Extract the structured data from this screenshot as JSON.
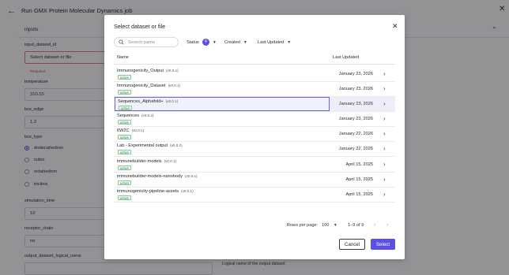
{
  "page": {
    "title": "Run GMX Protein Molecular Dynamics job",
    "section_title": "inputs",
    "fields": [
      {
        "label": "input_dataset_id",
        "value": "Select dataset or file",
        "required_note": "*Required"
      },
      {
        "label": "temperature",
        "value": "310.15"
      },
      {
        "label": "box_edge",
        "value": "1.2"
      },
      {
        "label": "box_type",
        "options": [
          "dodecahedron",
          "cubic",
          "octahedron",
          "triclinic"
        ],
        "selected": "dodecahedron"
      },
      {
        "label": "simulation_time",
        "value": "10"
      },
      {
        "label": "receptor_chain",
        "value": "no"
      },
      {
        "label": "output_dataset_logical_name",
        "value": ""
      }
    ],
    "right_hint_top": "d",
    "right_hint_bottom": "Logical name of the output dataset"
  },
  "modal": {
    "title": "Select dataset or file",
    "search": {
      "placeholder": "Search name",
      "value": ""
    },
    "filters": {
      "status_label": "Status",
      "status_count": "4",
      "created_label": "Created",
      "updated_label": "Last Updated"
    },
    "columns": {
      "name": "Name",
      "last_updated": "Last Updated"
    },
    "rows": [
      {
        "name": "Immunogenicity_Output",
        "version": "(v0.0.1)",
        "status": "active",
        "date": "January 23, 2026"
      },
      {
        "name": "Immunogenicity_Dataset",
        "version": "(v0.0.1)",
        "status": "active",
        "date": "January 23, 2026"
      },
      {
        "name": "Sequences_Alphafold+",
        "version": "(v0.0.1)",
        "status": "active",
        "date": "January 23, 2026"
      },
      {
        "name": "Sequences",
        "version": "(v0.0.2)",
        "status": "active",
        "date": "January 23, 2026"
      },
      {
        "name": "6W2C",
        "version": "(v0.0.1)",
        "status": "active",
        "date": "January 22, 2026"
      },
      {
        "name": "Lab - Experimental output",
        "version": "(v0.0.2)",
        "status": "active",
        "date": "January 22, 2026"
      },
      {
        "name": "immunebuilder-models",
        "version": "(v0.0.1)",
        "status": "active",
        "date": "April 15, 2025"
      },
      {
        "name": "immunebuilder-models-nanobody",
        "version": "(v0.0.1)",
        "status": "active",
        "date": "April 15, 2025"
      },
      {
        "name": "immunogenicity-pipeline-assets",
        "version": "(v0.0.1)",
        "status": "active",
        "date": "April 15, 2025"
      }
    ],
    "highlighted_row_index": 2,
    "pagination": {
      "rows_per_page_label": "Rows per page:",
      "rows_per_page": "100",
      "range": "1–9 of 9"
    },
    "buttons": {
      "cancel": "Cancel",
      "select": "Select"
    }
  },
  "colors": {
    "accent": "#5b4fe6",
    "status_active": "#3d8a4f",
    "required_error": "#c64545",
    "overlay": "rgba(16,16,22,0.45)"
  },
  "icons": {
    "back": "arrow-left-icon",
    "close": "close-icon",
    "search": "search-icon",
    "row_open": "chevron-right-icon",
    "section_toggle": "chevron-up-icon",
    "dropdown": "caret-down-icon"
  }
}
